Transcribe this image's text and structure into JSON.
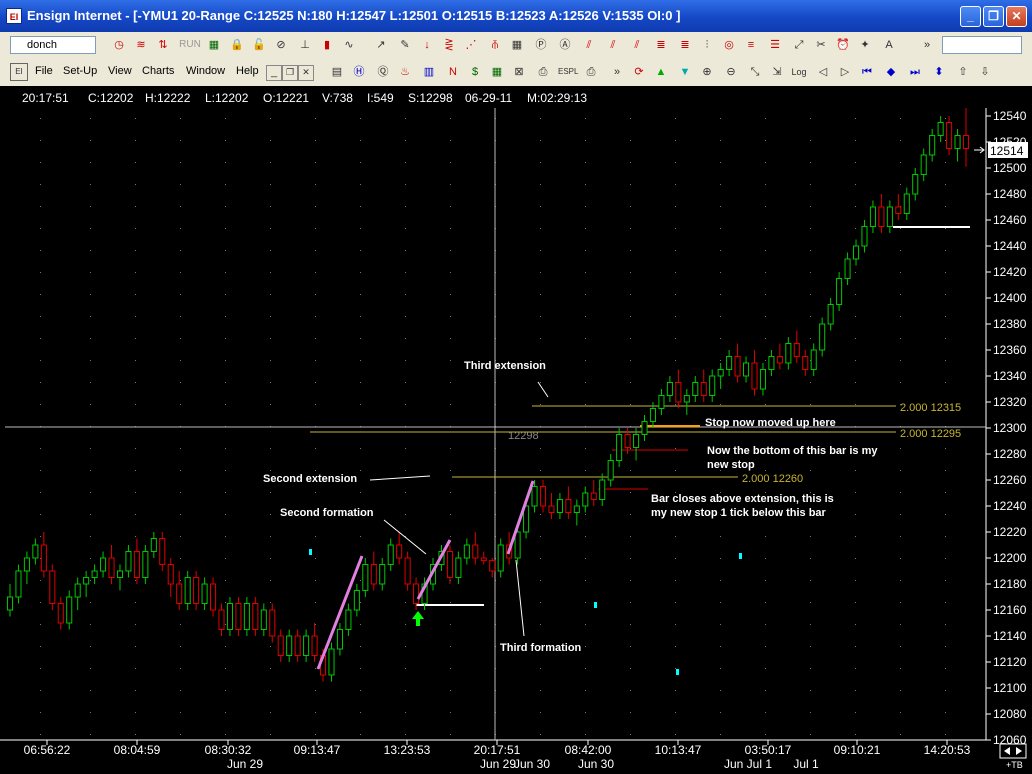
{
  "window": {
    "title": "Ensign Internet - [-YMU1 20-Range C:12525 N:180 H:12547 L:12501 O:12515 B:12523 A:12526 V:1535 OI:0 ]",
    "minimize_glyph": "_",
    "maximize_glyph": "❐",
    "close_glyph": "✕"
  },
  "toolbar1": {
    "combo_value": "donch",
    "disabled_label": "RUN"
  },
  "menu": [
    "File",
    "Set-Up",
    "View",
    "Charts",
    "Window",
    "Help"
  ],
  "status": {
    "time": "20:17:51",
    "close": "C:12202",
    "high": "H:12222",
    "low": "L:12202",
    "open": "O:12221",
    "volume": "V:738",
    "interval": "I:549",
    "s": "S:12298",
    "date": "06-29-11",
    "m": "M:02:29:13"
  },
  "price_axis": {
    "labels": [
      "12540",
      "12520",
      "12500",
      "12480",
      "12460",
      "12440",
      "12420",
      "12400",
      "12380",
      "12360",
      "12340",
      "12320",
      "12300",
      "12280",
      "12260",
      "12240",
      "12220",
      "12200",
      "12180",
      "12160",
      "12140",
      "12120",
      "12100",
      "12080",
      "12060"
    ],
    "current_price": "12514",
    "corner_label": "+TB"
  },
  "time_axis": {
    "times": [
      "06:56:22",
      "08:04:59",
      "08:30:32",
      "09:13:47",
      "13:23:53",
      "20:17:51",
      "08:42:00",
      "10:13:47",
      "03:50:17",
      "09:10:21",
      "14:20:53"
    ],
    "dates": [
      "Jun 29",
      "Jun 29",
      "Jun 30",
      "Jun 30",
      "Jun Jul 1",
      "Jul 1"
    ]
  },
  "annotations": {
    "third_extension": "Third extension",
    "second_extension": "Second extension",
    "second_formation": "Second formation",
    "third_formation": "Third formation",
    "stop_moved": "Stop now moved up here",
    "bottom_bar_1": "Now the bottom of this bar is my",
    "bottom_bar_2": "new stop",
    "bar_closes_1": "Bar closes above extension, this is",
    "bar_closes_2": "my new stop 1 tick below this bar",
    "ext_label_1": "2.000  12315",
    "ext_label_2": "2.000  12295",
    "ext_label_3": "2.000  12260",
    "cursor_price": "12298"
  },
  "colors": {
    "up": "#00c800",
    "down": "#e00000",
    "extension": "#c8b432",
    "annotation": "#ffffff",
    "marker": "#00ffff",
    "arrow": "#00ff00"
  },
  "chart_data": {
    "type": "candlestick",
    "ylim": [
      12050,
      12550
    ],
    "candles": [
      [
        12160,
        12180,
        12155,
        12170
      ],
      [
        12170,
        12195,
        12165,
        12190
      ],
      [
        12190,
        12205,
        12180,
        12200
      ],
      [
        12200,
        12215,
        12195,
        12210
      ],
      [
        12210,
        12220,
        12185,
        12190
      ],
      [
        12190,
        12195,
        12160,
        12165
      ],
      [
        12165,
        12170,
        12145,
        12150
      ],
      [
        12150,
        12175,
        12145,
        12170
      ],
      [
        12170,
        12185,
        12160,
        12180
      ],
      [
        12180,
        12190,
        12170,
        12185
      ],
      [
        12185,
        12195,
        12180,
        12190
      ],
      [
        12190,
        12205,
        12185,
        12200
      ],
      [
        12200,
        12210,
        12180,
        12185
      ],
      [
        12185,
        12195,
        12175,
        12190
      ],
      [
        12190,
        12210,
        12185,
        12205
      ],
      [
        12205,
        12215,
        12180,
        12185
      ],
      [
        12185,
        12210,
        12180,
        12205
      ],
      [
        12205,
        12220,
        12200,
        12215
      ],
      [
        12215,
        12220,
        12190,
        12195
      ],
      [
        12195,
        12200,
        12170,
        12180
      ],
      [
        12180,
        12190,
        12160,
        12165
      ],
      [
        12165,
        12190,
        12160,
        12185
      ],
      [
        12185,
        12190,
        12160,
        12165
      ],
      [
        12165,
        12185,
        12160,
        12180
      ],
      [
        12180,
        12185,
        12155,
        12160
      ],
      [
        12160,
        12165,
        12140,
        12145
      ],
      [
        12145,
        12170,
        12140,
        12165
      ],
      [
        12165,
        12170,
        12140,
        12145
      ],
      [
        12145,
        12170,
        12140,
        12165
      ],
      [
        12165,
        12170,
        12140,
        12145
      ],
      [
        12145,
        12165,
        12140,
        12160
      ],
      [
        12160,
        12165,
        12135,
        12140
      ],
      [
        12140,
        12145,
        12120,
        12125
      ],
      [
        12125,
        12145,
        12120,
        12140
      ],
      [
        12140,
        12145,
        12120,
        12125
      ],
      [
        12125,
        12145,
        12120,
        12140
      ],
      [
        12140,
        12150,
        12120,
        12125
      ],
      [
        12125,
        12130,
        12105,
        12110
      ],
      [
        12110,
        12135,
        12105,
        12130
      ],
      [
        12130,
        12150,
        12125,
        12145
      ],
      [
        12145,
        12165,
        12140,
        12160
      ],
      [
        12160,
        12180,
        12155,
        12175
      ],
      [
        12175,
        12200,
        12170,
        12195
      ],
      [
        12195,
        12205,
        12175,
        12180
      ],
      [
        12180,
        12200,
        12175,
        12195
      ],
      [
        12195,
        12215,
        12190,
        12210
      ],
      [
        12210,
        12220,
        12195,
        12200
      ],
      [
        12200,
        12205,
        12175,
        12180
      ],
      [
        12180,
        12185,
        12160,
        12165
      ],
      [
        12165,
        12185,
        12160,
        12180
      ],
      [
        12180,
        12200,
        12175,
        12195
      ],
      [
        12195,
        12210,
        12190,
        12205
      ],
      [
        12205,
        12210,
        12180,
        12185
      ],
      [
        12185,
        12205,
        12180,
        12200
      ],
      [
        12200,
        12215,
        12195,
        12210
      ],
      [
        12210,
        12220,
        12195,
        12200
      ],
      [
        12200,
        12205,
        12195,
        12198
      ],
      [
        12198,
        12200,
        12185,
        12190
      ],
      [
        12190,
        12215,
        12185,
        12210
      ],
      [
        12210,
        12220,
        12195,
        12200
      ],
      [
        12200,
        12225,
        12195,
        12220
      ],
      [
        12220,
        12245,
        12215,
        12240
      ],
      [
        12240,
        12260,
        12235,
        12255
      ],
      [
        12255,
        12260,
        12235,
        12240
      ],
      [
        12240,
        12250,
        12230,
        12235
      ],
      [
        12235,
        12250,
        12230,
        12245
      ],
      [
        12245,
        12255,
        12230,
        12235
      ],
      [
        12235,
        12245,
        12225,
        12240
      ],
      [
        12240,
        12255,
        12235,
        12250
      ],
      [
        12250,
        12260,
        12240,
        12245
      ],
      [
        12245,
        12265,
        12240,
        12260
      ],
      [
        12260,
        12280,
        12255,
        12275
      ],
      [
        12275,
        12300,
        12270,
        12295
      ],
      [
        12295,
        12300,
        12280,
        12285
      ],
      [
        12285,
        12300,
        12275,
        12295
      ],
      [
        12295,
        12310,
        12290,
        12305
      ],
      [
        12305,
        12320,
        12300,
        12315
      ],
      [
        12315,
        12330,
        12310,
        12325
      ],
      [
        12325,
        12340,
        12320,
        12335
      ],
      [
        12335,
        12345,
        12315,
        12320
      ],
      [
        12320,
        12330,
        12310,
        12325
      ],
      [
        12325,
        12340,
        12320,
        12335
      ],
      [
        12335,
        12345,
        12320,
        12325
      ],
      [
        12325,
        12345,
        12320,
        12340
      ],
      [
        12340,
        12350,
        12330,
        12345
      ],
      [
        12345,
        12360,
        12340,
        12355
      ],
      [
        12355,
        12365,
        12335,
        12340
      ],
      [
        12340,
        12355,
        12335,
        12350
      ],
      [
        12350,
        12360,
        12325,
        12330
      ],
      [
        12330,
        12350,
        12325,
        12345
      ],
      [
        12345,
        12360,
        12340,
        12355
      ],
      [
        12355,
        12365,
        12345,
        12350
      ],
      [
        12350,
        12370,
        12345,
        12365
      ],
      [
        12365,
        12375,
        12350,
        12355
      ],
      [
        12355,
        12360,
        12340,
        12345
      ],
      [
        12345,
        12365,
        12340,
        12360
      ],
      [
        12360,
        12385,
        12355,
        12380
      ],
      [
        12380,
        12400,
        12375,
        12395
      ],
      [
        12395,
        12420,
        12390,
        12415
      ],
      [
        12415,
        12435,
        12410,
        12430
      ],
      [
        12430,
        12445,
        12425,
        12440
      ],
      [
        12440,
        12460,
        12435,
        12455
      ],
      [
        12455,
        12475,
        12450,
        12470
      ],
      [
        12470,
        12480,
        12450,
        12455
      ],
      [
        12455,
        12475,
        12450,
        12470
      ],
      [
        12470,
        12480,
        12460,
        12465
      ],
      [
        12465,
        12485,
        12460,
        12480
      ],
      [
        12480,
        12500,
        12475,
        12495
      ],
      [
        12495,
        12515,
        12490,
        12510
      ],
      [
        12510,
        12530,
        12505,
        12525
      ],
      [
        12525,
        12540,
        12520,
        12535
      ],
      [
        12535,
        12540,
        12510,
        12515
      ],
      [
        12515,
        12530,
        12505,
        12525
      ],
      [
        12525,
        12547,
        12501,
        12515
      ]
    ]
  }
}
